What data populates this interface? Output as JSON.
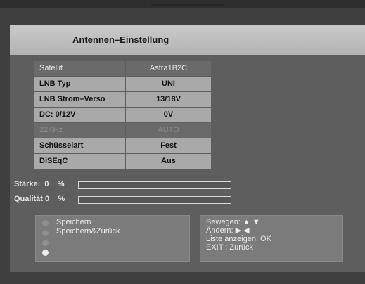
{
  "title": "Antennen–Einstellung",
  "table": {
    "header": {
      "label": "Satellit",
      "value": "Astra1B2C"
    },
    "rows": [
      {
        "label": "LNB Typ",
        "value": "UNI"
      },
      {
        "label": "LNB Strom–Verso",
        "value": "13/18V"
      },
      {
        "label": "DC: 0/12V",
        "value": "0V"
      },
      {
        "label": "22KHz",
        "value": "AUTO"
      },
      {
        "label": "Schüsselart",
        "value": "Fest"
      },
      {
        "label": "DiSEqC",
        "value": "Aus"
      }
    ]
  },
  "signal": {
    "strength_label": "Stärke:  0    %",
    "strength_value": 0,
    "quality_label": "Qualität 0    %",
    "quality_value": 0
  },
  "options": {
    "save": "Speichern",
    "save_back": "Speichern&Zurück"
  },
  "help": {
    "move": "Bewegen: ▲ ▼",
    "change": "Ändern: ▶ ◀",
    "list": "Liste anzeigen: OK",
    "exit": "EXIT : Zurück"
  }
}
